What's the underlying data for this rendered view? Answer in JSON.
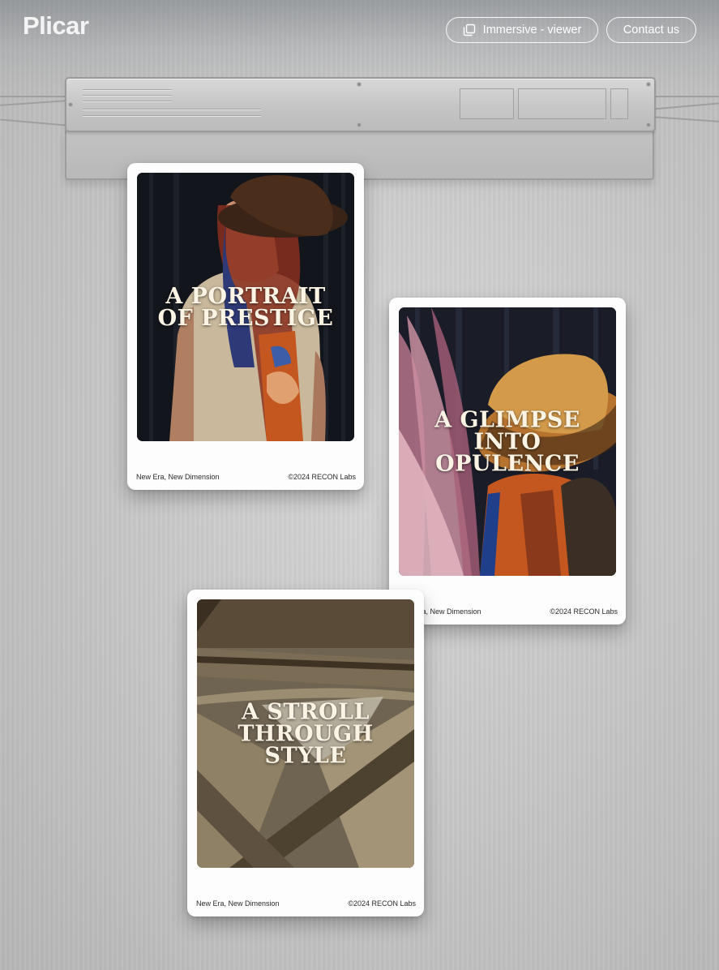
{
  "header": {
    "logo": "Plicar",
    "immersive_button": "Immersive - viewer",
    "contact_button": "Contact us"
  },
  "cards": [
    {
      "title": "A PORTRAIT\nOF PRESTIGE",
      "footer_left": "New Era, New Dimension",
      "footer_right": "©2024 RECON Labs"
    },
    {
      "title": "A GLIMPSE\nINTO OPULENCE",
      "footer_left": "New Era, New Dimension",
      "footer_right": "©2024 RECON Labs"
    },
    {
      "title": "A STROLL\nTHROUGH STYLE",
      "footer_left": "New Era, New Dimension",
      "footer_right": "©2024 RECON Labs"
    }
  ],
  "icons": {
    "immersive": "window-stack-icon"
  },
  "colors": {
    "background": "#c8c8c8",
    "card": "#fdfdfd",
    "header_text": "#ffffff"
  }
}
